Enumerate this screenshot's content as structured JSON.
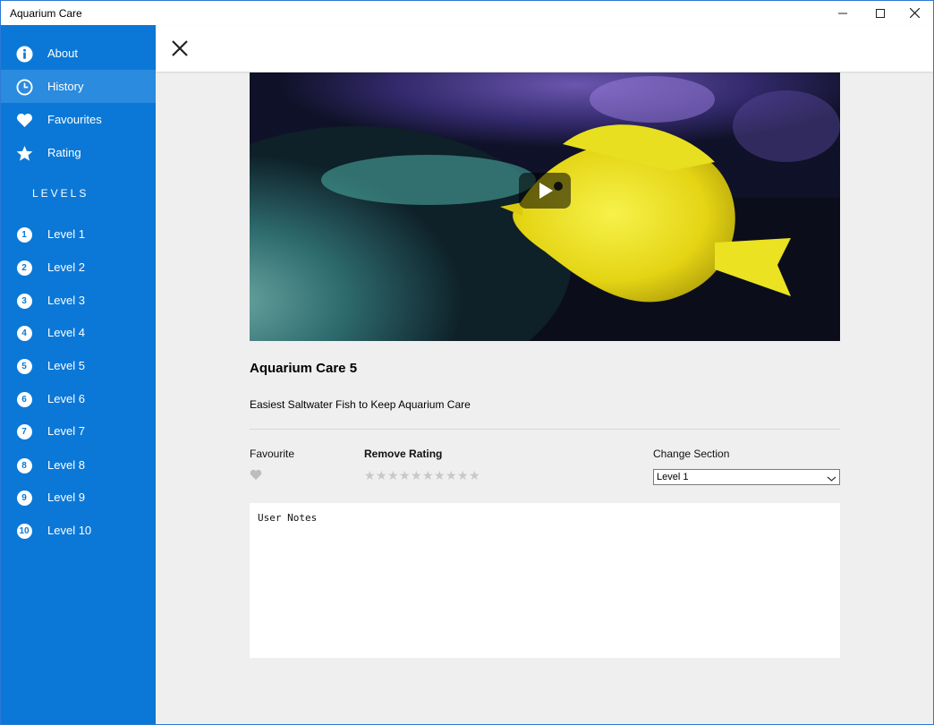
{
  "window": {
    "title": "Aquarium Care",
    "controls": {
      "minimize": "—",
      "maximize": "☐",
      "close": "✕"
    }
  },
  "sidebar": {
    "items": [
      {
        "label": "About",
        "icon": "info-icon"
      },
      {
        "label": "History",
        "icon": "clock-icon",
        "selected": true
      },
      {
        "label": "Favourites",
        "icon": "heart-icon"
      },
      {
        "label": "Rating",
        "icon": "star-icon"
      }
    ],
    "levels_heading": "LEVELS",
    "levels": [
      {
        "num": "1",
        "label": "Level 1"
      },
      {
        "num": "2",
        "label": "Level 2"
      },
      {
        "num": "3",
        "label": "Level 3"
      },
      {
        "num": "4",
        "label": "Level 4"
      },
      {
        "num": "5",
        "label": "Level 5"
      },
      {
        "num": "6",
        "label": "Level 6"
      },
      {
        "num": "7",
        "label": "Level 7"
      },
      {
        "num": "8",
        "label": "Level 8"
      },
      {
        "num": "9",
        "label": "Level 9"
      },
      {
        "num": "10",
        "label": "Level 10"
      }
    ],
    "accent": "#0b78d7"
  },
  "content": {
    "title": "Aquarium Care 5",
    "description": "Easiest Saltwater Fish to Keep Aquarium Care",
    "favourite_label": "Favourite",
    "rating_label": "Remove Rating",
    "rating": {
      "value": 0,
      "max": 10
    },
    "section_label": "Change Section",
    "section_value": "Level 1",
    "notes": "User Notes"
  }
}
